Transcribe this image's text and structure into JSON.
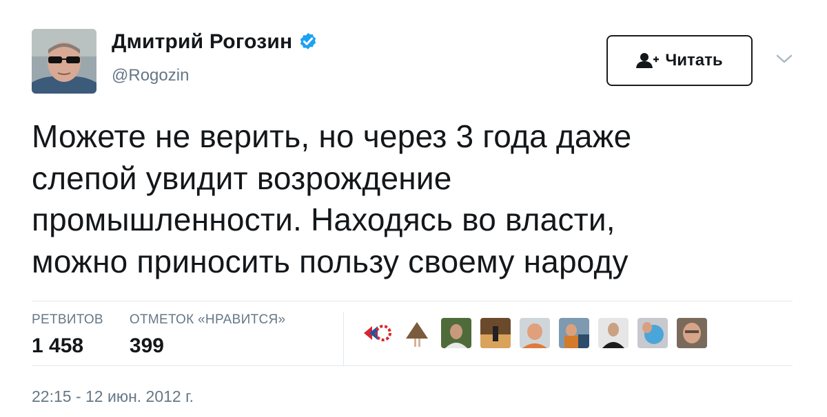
{
  "user": {
    "display_name": "Дмитрий Рогозин",
    "handle": "@Rogozin",
    "verified": true
  },
  "follow_button": {
    "label": "Читать",
    "icon": "add-user-icon"
  },
  "tweet": {
    "lines": [
      "Можете не верить, но через 3 года даже",
      "слепой увидит возрождение",
      "промышленности. Находясь во власти,",
      "можно приносить пользу своему народу"
    ]
  },
  "stats": {
    "retweets": {
      "label": "РЕТВИТОВ",
      "value": "1 458"
    },
    "likes": {
      "label": "ОТМЕТОК «НРАВИТСЯ»",
      "value": "399"
    }
  },
  "timestamp": "22:15 - 12 июн. 2012 г.",
  "colors": {
    "accent": "#1da1f2",
    "secondary_text": "#657786",
    "divider": "#e1e8ed"
  }
}
